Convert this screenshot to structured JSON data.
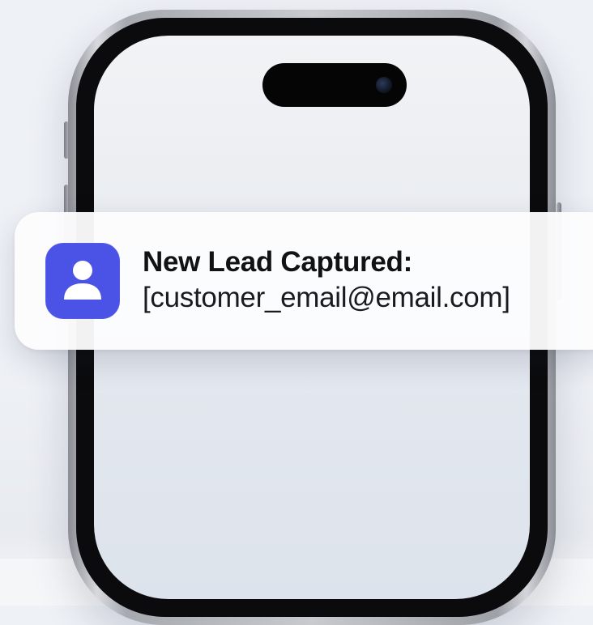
{
  "notification": {
    "icon": "user-icon",
    "title": "New Lead Captured:",
    "body": "[customer_email@email.com]"
  },
  "colors": {
    "app_icon_background": "#4b52e6",
    "notification_background": "#fcfcfd",
    "page_background": "#eef1f6",
    "phone_frame": "#0b0b0d"
  }
}
